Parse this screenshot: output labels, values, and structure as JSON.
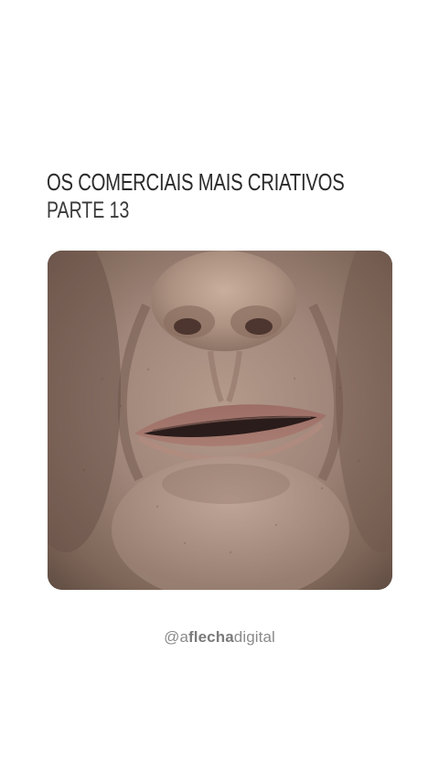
{
  "post": {
    "title": "OS COMERCIAIS MAIS CRIATIVOS",
    "subtitle": "PARTE 13",
    "media": {
      "kind": "video-frame",
      "subject": "close-up-face"
    },
    "handle": {
      "at": "@a",
      "bold": "flecha",
      "rest": "digital"
    }
  },
  "colors": {
    "background": "#ffffff",
    "title": "#2a2a2a",
    "handle": "#8a8a8a"
  }
}
